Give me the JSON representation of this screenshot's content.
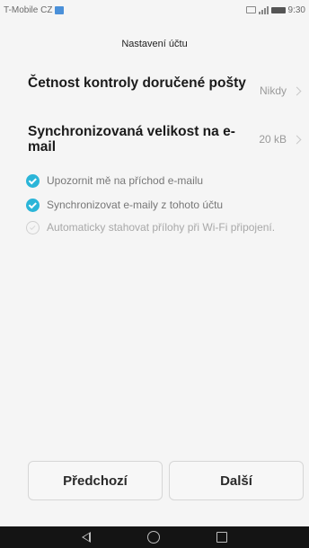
{
  "status_bar": {
    "carrier": "T-Mobile CZ",
    "time": "9:30"
  },
  "header": {
    "title": "Nastavení účtu"
  },
  "settings": [
    {
      "title": "Četnost kontroly doručené pošty",
      "value": "Nikdy"
    },
    {
      "title": "Synchronizovaná velikost na e-mail",
      "value": "20 kB"
    }
  ],
  "checkboxes": [
    {
      "label": "Upozornit mě na příchod e-mailu",
      "checked": true
    },
    {
      "label": "Synchronizovat e-maily z tohoto účtu",
      "checked": true
    },
    {
      "label": "Automaticky stahovat přílohy při Wi-Fi připojení.",
      "checked": false
    }
  ],
  "buttons": {
    "previous_label": "Předchozí",
    "next_label": "Další"
  },
  "colors": {
    "accent": "#2bb5d8",
    "background": "#f5f5f5",
    "nav_bar": "#141414"
  },
  "icons": [
    "sim-card-icon",
    "message-icon",
    "signal-icon",
    "battery-icon",
    "chevron-right-icon",
    "check-circle-icon",
    "back-icon",
    "home-icon",
    "recent-apps-icon"
  ]
}
